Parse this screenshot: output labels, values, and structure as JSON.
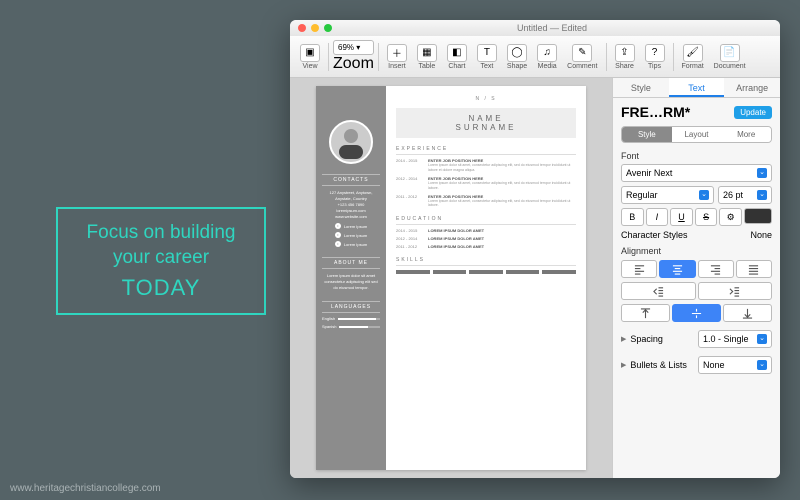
{
  "promo": {
    "line1": "Focus on building",
    "line2": "your career",
    "line3": "TODAY"
  },
  "watermark": "www.heritagechristiancollege.com",
  "window": {
    "title": "Untitled — Edited",
    "zoom": "69%"
  },
  "toolbar": [
    {
      "id": "view",
      "label": "View",
      "glyph": "▣"
    },
    {
      "id": "zoom",
      "label": "Zoom"
    },
    {
      "id": "insert",
      "label": "Insert",
      "glyph": "＋"
    },
    {
      "id": "table",
      "label": "Table",
      "glyph": "▦"
    },
    {
      "id": "chart",
      "label": "Chart",
      "glyph": "◧"
    },
    {
      "id": "text",
      "label": "Text",
      "glyph": "T"
    },
    {
      "id": "shape",
      "label": "Shape",
      "glyph": "◯"
    },
    {
      "id": "media",
      "label": "Media",
      "glyph": "♫"
    },
    {
      "id": "comment",
      "label": "Comment",
      "glyph": "✎"
    },
    {
      "id": "share",
      "label": "Share",
      "glyph": "⇪"
    },
    {
      "id": "tips",
      "label": "Tips",
      "glyph": "?"
    },
    {
      "id": "format",
      "label": "Format",
      "glyph": "🖌"
    },
    {
      "id": "document",
      "label": "Document",
      "glyph": "📄"
    }
  ],
  "resume": {
    "monogram": "N / S",
    "name_first": "NAME",
    "name_last": "SURNAME",
    "sidebar": {
      "contacts_h": "CONTACTS",
      "contacts": [
        "127 Anystreet, Anytown,",
        "Anystate, Country",
        "+123 456 7890",
        "loremipsum.com",
        "www.website.com"
      ],
      "social": [
        "Lorem Ipsum",
        "Lorem Ipsum",
        "Lorem Ipsum"
      ],
      "about_h": "ABOUT ME",
      "about": "Lorem ipsum dolor sit amet consectetur adipiscing elit sed do eiusmod tempor.",
      "lang_h": "LANGUAGES",
      "languages": [
        {
          "name": "English",
          "pct": 90
        },
        {
          "name": "Spanish",
          "pct": 70
        }
      ]
    },
    "sections": {
      "exp_h": "EXPERIENCE",
      "exp": [
        {
          "years": "2014 - 2015",
          "title": "ENTER JOB POSITION HERE",
          "desc": "Lorem ipsum dolor sit amet, consectetur adipiscing elit, sed do eiusmod tempor incididunt ut labore et dolore magna aliqua."
        },
        {
          "years": "2012 - 2014",
          "title": "ENTER JOB POSITION HERE",
          "desc": "Lorem ipsum dolor sit amet, consectetur adipiscing elit, sed do eiusmod tempor incididunt ut labore."
        },
        {
          "years": "2011 - 2012",
          "title": "ENTER JOB POSITION HERE",
          "desc": "Lorem ipsum dolor sit amet, consectetur adipiscing elit, sed do eiusmod tempor incididunt ut labore."
        }
      ],
      "edu_h": "EDUCATION",
      "edu": [
        {
          "years": "2014 - 2015",
          "title": "LOREM IPSUM DOLOR AMET"
        },
        {
          "years": "2012 - 2014",
          "title": "LOREM IPSUM DOLOR AMET"
        },
        {
          "years": "2011 - 2012",
          "title": "LOREM IPSUM DOLOR AMET"
        }
      ],
      "skills_h": "SKILLS"
    }
  },
  "inspector": {
    "tabs": {
      "style": "Style",
      "text": "Text",
      "arrange": "Arrange"
    },
    "style_name": "FRE…RM*",
    "update": "Update",
    "seg": {
      "style": "Style",
      "layout": "Layout",
      "more": "More"
    },
    "font_h": "Font",
    "font_family": "Avenir Next",
    "font_style": "Regular",
    "font_size": "26 pt",
    "bold": "B",
    "italic": "I",
    "underline": "U",
    "strike": "S",
    "gear": "⚙",
    "char_styles": "Character Styles",
    "char_value": "None",
    "align_h": "Alignment",
    "spacing": "Spacing",
    "spacing_val": "1.0 - Single",
    "bullets": "Bullets & Lists",
    "bullets_val": "None"
  }
}
